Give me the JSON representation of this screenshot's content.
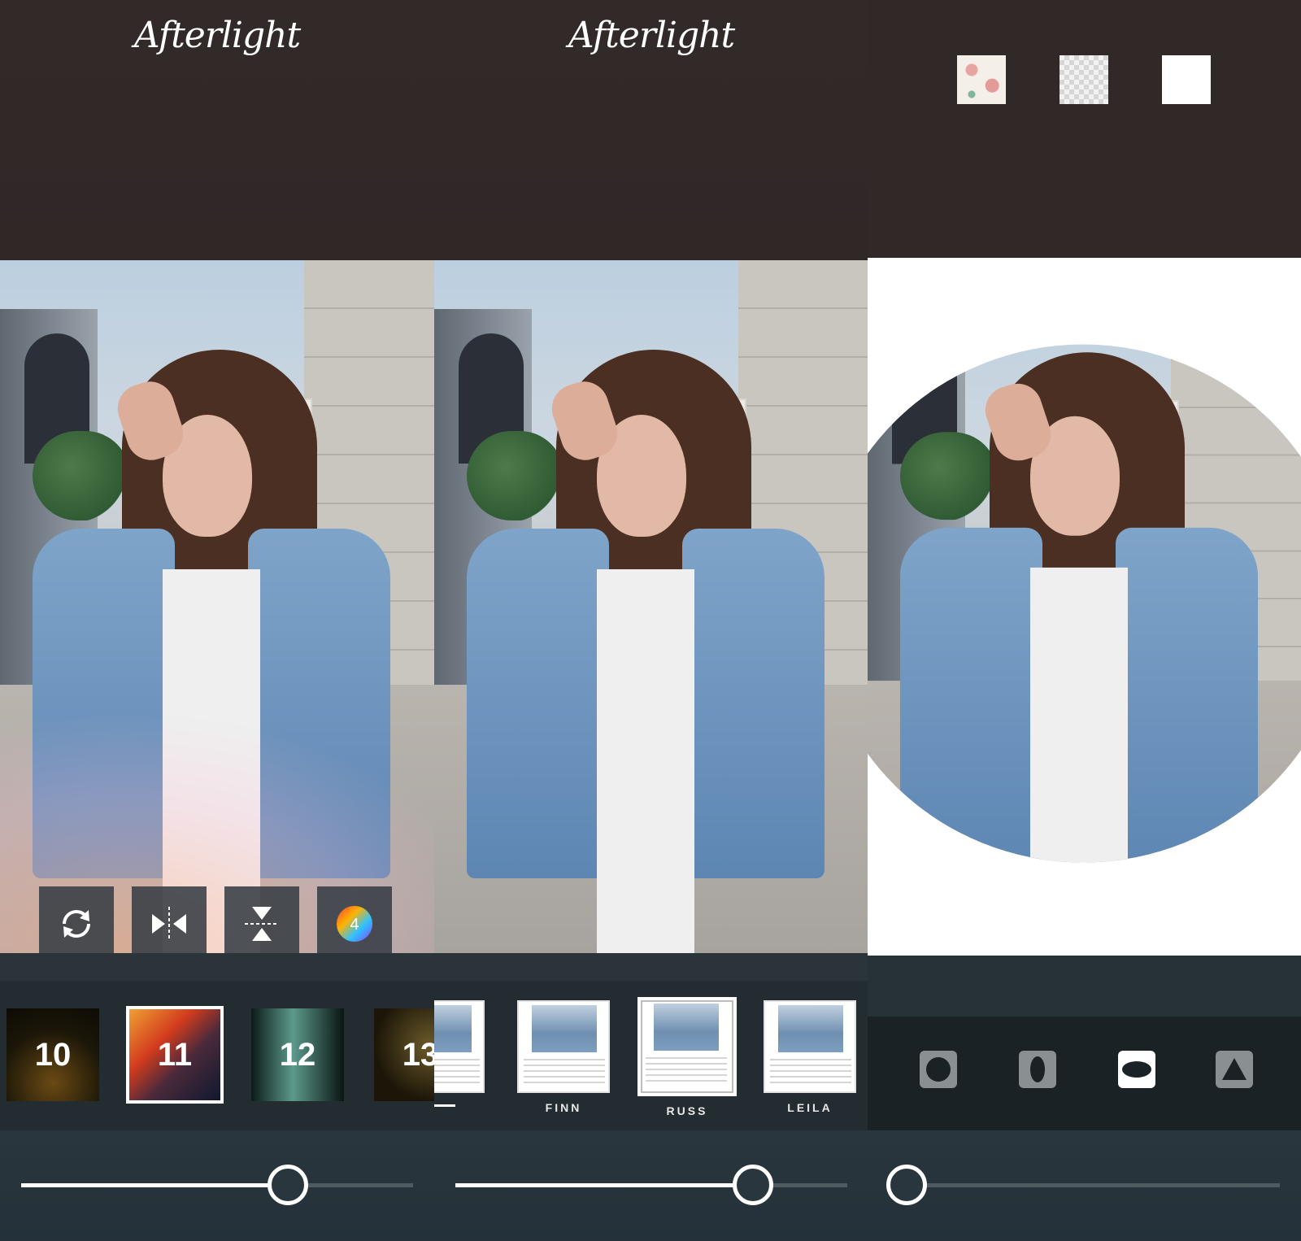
{
  "panel1": {
    "logo": "Afterlight",
    "tools": [
      {
        "name": "rotate",
        "icon": "rotate-icon"
      },
      {
        "name": "flip-horizontal",
        "icon": "flip-horizontal-icon"
      },
      {
        "name": "flip-vertical",
        "icon": "flip-vertical-icon"
      },
      {
        "name": "color",
        "icon": "color-wheel-icon",
        "badge": "4"
      }
    ],
    "overlays": [
      {
        "label": "10",
        "selected": false
      },
      {
        "label": "11",
        "selected": true
      },
      {
        "label": "12",
        "selected": false
      },
      {
        "label": "13",
        "selected": false
      }
    ],
    "slider_value": 0.68
  },
  "panel2": {
    "logo": "Afterlight",
    "frames": [
      {
        "label": "",
        "selected": false
      },
      {
        "label": "FINN",
        "selected": false
      },
      {
        "label": "RUSS",
        "selected": true
      },
      {
        "label": "LEILA",
        "selected": false
      }
    ],
    "slider_value": 0.76
  },
  "panel3": {
    "backgrounds": [
      {
        "name": "floral",
        "icon": "floral-pattern-icon"
      },
      {
        "name": "transparent",
        "icon": "transparent-checker-icon"
      },
      {
        "name": "white",
        "icon": "white-square-icon"
      }
    ],
    "shapes": [
      {
        "name": "circle",
        "icon": "circle-shape-icon",
        "selected": false
      },
      {
        "name": "vertical-ellipse",
        "icon": "vertical-ellipse-icon",
        "selected": false
      },
      {
        "name": "horizontal-ellipse",
        "icon": "horizontal-ellipse-icon",
        "selected": true
      },
      {
        "name": "triangle",
        "icon": "triangle-shape-icon",
        "selected": false
      }
    ],
    "slider_value": 0.0
  },
  "colors": {
    "top_bg": "#302927",
    "bar_bg": "#232c31",
    "slider_bg": "#2a363d",
    "accent": "#ffffff"
  }
}
